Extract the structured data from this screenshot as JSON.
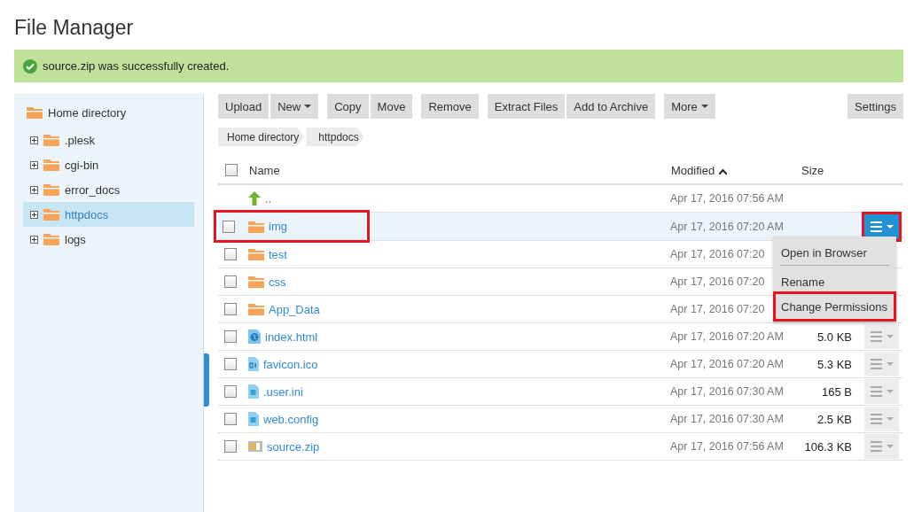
{
  "title": "File Manager",
  "notice": {
    "text": "source.zip was successfully created."
  },
  "sidebar": {
    "root": "Home directory",
    "items": [
      {
        "label": ".plesk",
        "selected": false
      },
      {
        "label": "cgi-bin",
        "selected": false
      },
      {
        "label": "error_docs",
        "selected": false
      },
      {
        "label": "httpdocs",
        "selected": true
      },
      {
        "label": "logs",
        "selected": false
      }
    ]
  },
  "toolbar": [
    [
      "Upload",
      {
        "label": "New",
        "dropdown": true
      }
    ],
    [
      "Copy",
      "Move"
    ],
    [
      "Remove"
    ],
    [
      "Extract Files",
      "Add to Archive"
    ],
    [
      {
        "label": "More",
        "dropdown": true
      }
    ]
  ],
  "settings": "Settings",
  "breadcrumb": [
    "Home directory",
    "httpdocs"
  ],
  "table": {
    "select_all_checked": false,
    "columns": [
      {
        "label": "Name",
        "sorted": false
      },
      {
        "label": "Modified",
        "sorted": true
      },
      {
        "label": "Size",
        "sorted": false
      }
    ],
    "rows": [
      {
        "kind": "up",
        "name": "..",
        "modified": "Apr 17, 2016 07:56 AM",
        "highlighted": false,
        "active": false
      },
      {
        "kind": "folder",
        "name": "img",
        "modified": "Apr 17, 2016 07:20 AM",
        "checked": false,
        "highlighted": true,
        "active": true
      },
      {
        "kind": "folder",
        "name": "test",
        "modified": "Apr 17, 2016 07:20",
        "checked": false,
        "highlighted": false,
        "active": false
      },
      {
        "kind": "folder",
        "name": "css",
        "modified": "Apr 17, 2016 07:20",
        "checked": false,
        "highlighted": false,
        "active": false
      },
      {
        "kind": "folder",
        "name": "App_Data",
        "modified": "Apr 17, 2016 07:20",
        "checked": false,
        "highlighted": false,
        "active": false
      },
      {
        "kind": "web",
        "name": "index.html",
        "modified": "Apr 17, 2016 07:20 AM",
        "size": "5.0 KB",
        "checked": false,
        "highlighted": false,
        "active": false
      },
      {
        "kind": "binary",
        "name": "favicon.ico",
        "modified": "Apr 17, 2016 07:20 AM",
        "size": "5.3 KB",
        "checked": false,
        "highlighted": false,
        "active": false
      },
      {
        "kind": "file",
        "name": ".user.ini",
        "modified": "Apr 17, 2016 07:30 AM",
        "size": "165 B",
        "checked": false,
        "highlighted": false,
        "active": false
      },
      {
        "kind": "file",
        "name": "web.config",
        "modified": "Apr 17, 2016 07:30 AM",
        "size": "2.5 KB",
        "checked": false,
        "highlighted": false,
        "active": false
      },
      {
        "kind": "zip",
        "name": "source.zip",
        "modified": "Apr 17, 2016 07:56 AM",
        "size": "106.3 KB",
        "checked": false,
        "highlighted": false,
        "active": false
      }
    ]
  },
  "context_menu": {
    "items": [
      {
        "label": "Open in Browser",
        "highlighted": false,
        "separator_after": true
      },
      {
        "label": "Rename",
        "highlighted": false,
        "separator_after": false
      },
      {
        "label": "Change Permissions",
        "highlighted": true,
        "separator_after": false
      }
    ]
  }
}
